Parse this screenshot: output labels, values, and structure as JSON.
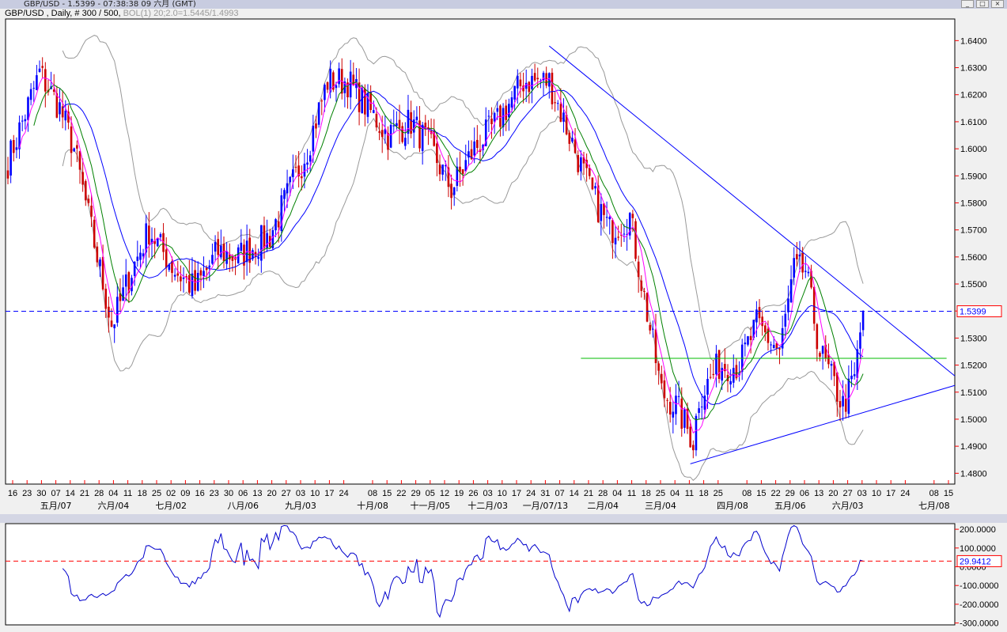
{
  "window": {
    "title": "GBP/USD - 1.5399 - 07:38:38 09 六月 (GMT)"
  },
  "header": {
    "symbol_info": "GBP/USD , Daily, # 300 / 500,",
    "indicator": "BOL(1) 20;2.0=1.5445/1.4993"
  },
  "colors": {
    "up": "#0000ff",
    "down": "#cc0000",
    "ma_fast": "#ff00ff",
    "ma_mid": "#008000",
    "ma_slow": "#0000ff",
    "bands": "#999999",
    "cci": "#0000cc",
    "resistance": "#0000ff",
    "support_h": "#00bb00"
  },
  "chart_data": [
    {
      "type": "line",
      "title": "GBP/USD Daily candlestick with moving averages and Bollinger Bands",
      "ylim": [
        1.476,
        1.648
      ],
      "y_ticks": [
        "1.6400",
        "1.6300",
        "1.6200",
        "1.6100",
        "1.6000",
        "1.5900",
        "1.5800",
        "1.5700",
        "1.5600",
        "1.5500",
        "1.5400",
        "1.5300",
        "1.5200",
        "1.5100",
        "1.5000",
        "1.4900",
        "1.4800"
      ],
      "x_day_labels": [
        "16",
        "23",
        "30",
        "07",
        "14",
        "21",
        "28",
        "04",
        "11",
        "18",
        "25",
        "02",
        "09",
        "16",
        "23",
        "30",
        "06",
        "13",
        "20",
        "27",
        "03",
        "10",
        "17",
        "24",
        "",
        "08",
        "15",
        "22",
        "29",
        "05",
        "12",
        "19",
        "26",
        "03",
        "10",
        "17",
        "24",
        "31",
        "07",
        "14",
        "21",
        "28",
        "04",
        "11",
        "18",
        "25",
        "04",
        "11",
        "18",
        "25",
        "",
        "08",
        "15",
        "22",
        "29",
        "06",
        "13",
        "20",
        "27",
        "03",
        "10",
        "17",
        "24",
        "",
        "08",
        "15"
      ],
      "x_month_labels": [
        {
          "slot": 3,
          "label": "五月/07"
        },
        {
          "slot": 7,
          "label": "六月/04"
        },
        {
          "slot": 11,
          "label": "七月/02"
        },
        {
          "slot": 16,
          "label": "八月/06"
        },
        {
          "slot": 20,
          "label": "九月/03"
        },
        {
          "slot": 25,
          "label": "十月/08"
        },
        {
          "slot": 29,
          "label": "十一月/05"
        },
        {
          "slot": 33,
          "label": "十二月/03"
        },
        {
          "slot": 37,
          "label": "一月/07/13"
        },
        {
          "slot": 41,
          "label": "二月/04"
        },
        {
          "slot": 45,
          "label": "三月/04"
        },
        {
          "slot": 50,
          "label": "四月/08"
        },
        {
          "slot": 54,
          "label": "五月/06"
        },
        {
          "slot": 58,
          "label": "六月/03"
        },
        {
          "slot": 64,
          "label": "七月/08"
        }
      ],
      "bars": 298,
      "close_keypoints": [
        [
          0,
          1.595
        ],
        [
          11,
          1.628
        ],
        [
          18,
          1.615
        ],
        [
          23,
          1.6
        ],
        [
          30,
          1.565
        ],
        [
          36,
          1.535
        ],
        [
          38,
          1.54
        ],
        [
          43,
          1.555
        ],
        [
          49,
          1.57
        ],
        [
          58,
          1.555
        ],
        [
          65,
          1.548
        ],
        [
          73,
          1.562
        ],
        [
          80,
          1.56
        ],
        [
          91,
          1.568
        ],
        [
          98,
          1.585
        ],
        [
          104,
          1.6
        ],
        [
          111,
          1.625
        ],
        [
          118,
          1.625
        ],
        [
          125,
          1.615
        ],
        [
          132,
          1.605
        ],
        [
          140,
          1.61
        ],
        [
          147,
          1.6
        ],
        [
          154,
          1.585
        ],
        [
          162,
          1.6
        ],
        [
          170,
          1.61
        ],
        [
          179,
          1.625
        ],
        [
          188,
          1.625
        ],
        [
          195,
          1.605
        ],
        [
          202,
          1.585
        ],
        [
          209,
          1.57
        ],
        [
          216,
          1.575
        ],
        [
          221,
          1.545
        ],
        [
          227,
          1.51
        ],
        [
          232,
          1.505
        ],
        [
          238,
          1.492
        ],
        [
          240,
          1.508
        ],
        [
          247,
          1.52
        ],
        [
          254,
          1.52
        ],
        [
          260,
          1.535
        ],
        [
          268,
          1.525
        ],
        [
          273,
          1.555
        ],
        [
          277,
          1.555
        ],
        [
          282,
          1.525
        ],
        [
          286,
          1.515
        ],
        [
          290,
          1.505
        ],
        [
          294,
          1.515
        ],
        [
          297,
          1.54
        ]
      ],
      "current_price": "1.5399",
      "current_price_value": 1.5399,
      "trendlines": [
        {
          "name": "resistance",
          "from": [
            188,
            1.638
          ],
          "to": [
            329,
            1.516
          ]
        },
        {
          "name": "support",
          "from": [
            237,
            1.4835
          ],
          "to": [
            329,
            1.5125
          ]
        },
        {
          "name": "horizontal",
          "from": [
            199,
            1.5225
          ],
          "to": [
            326,
            1.5225
          ]
        }
      ],
      "indicators": [
        "MA5",
        "MA10",
        "MA20",
        "BOL(20,2.0)"
      ]
    },
    {
      "type": "line",
      "title": "CCI",
      "ylim": [
        -310,
        230
      ],
      "y_ticks": [
        {
          "v": 200,
          "label": "200.0000"
        },
        {
          "v": 100,
          "label": "100.0000"
        },
        {
          "v": 0,
          "label": "0.0000"
        },
        {
          "v": -100,
          "label": "-100.0000"
        },
        {
          "v": -200,
          "label": "-200.0000"
        },
        {
          "v": -300,
          "label": "-300.0000"
        }
      ],
      "current_value": "29.9412",
      "current_value_num": 29.9412
    }
  ]
}
